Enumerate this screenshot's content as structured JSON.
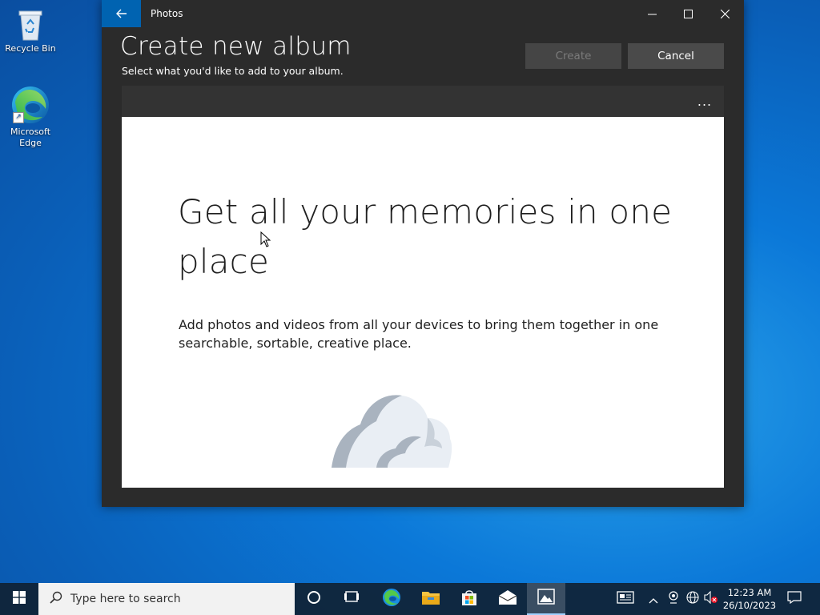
{
  "desktop": {
    "icons": [
      {
        "label": "Recycle Bin"
      },
      {
        "label": "Microsoft Edge"
      }
    ]
  },
  "window": {
    "title": "Photos",
    "back_icon": "arrow-left-icon",
    "controls": [
      "minimize-icon",
      "maximize-icon",
      "close-icon"
    ]
  },
  "header": {
    "title": "Create new album",
    "subtitle": "Select what you'd like to add to your album.",
    "create_label": "Create",
    "cancel_label": "Cancel",
    "create_enabled": false
  },
  "toolbar": {
    "more_label": "..."
  },
  "promo": {
    "headline": "Get all your memories in one place",
    "body": "Add photos and videos from all your devices to bring them together in one searchable, sortable, creative place.",
    "illustration": "cloud-icon"
  },
  "taskbar": {
    "search_placeholder": "Type here to search",
    "pinned": [
      "cortana-icon",
      "task-view-icon",
      "edge-icon",
      "file-explorer-icon",
      "store-icon",
      "mail-icon",
      "photos-icon"
    ],
    "active_app": "Photos",
    "tray": {
      "time": "12:23 AM",
      "date": "26/10/2023"
    }
  },
  "colors": {
    "accent": "#0063b1",
    "window_bg": "#2b2b2b",
    "content_bg": "#ffffff"
  }
}
